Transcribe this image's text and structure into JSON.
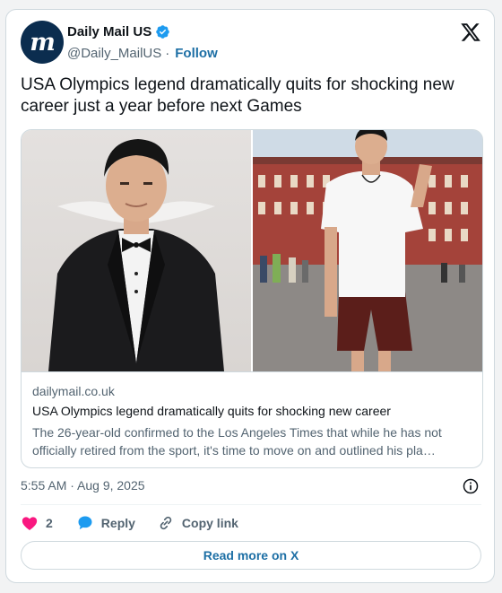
{
  "author": {
    "display_name": "Daily Mail US",
    "handle": "@Daily_MailUS",
    "separator": "·",
    "follow_label": "Follow",
    "avatar_letter": "m"
  },
  "tweet": {
    "text": "USA Olympics legend dramatically quits for shocking new career just a year before next Games"
  },
  "link_card": {
    "domain": "dailymail.co.uk",
    "title": "USA Olympics legend dramatically quits for shocking new career",
    "description": "The 26-year-old confirmed to the Los Angeles Times that while he has not officially retired from the sport, it's time to move on and outlined his pla…"
  },
  "meta": {
    "timestamp": "5:55 AM · Aug 9, 2025"
  },
  "actions": {
    "like_count": "2",
    "reply_label": "Reply",
    "copy_link_label": "Copy link"
  },
  "footer": {
    "read_more_label": "Read more on X"
  },
  "colors": {
    "accent": "#1d6fa5",
    "like": "#f91880",
    "reply": "#1d9bf0",
    "verified": "#1d9bf0",
    "avatar_bg": "#0b2d4f"
  },
  "icons": {
    "verified": "verified-badge-icon",
    "x": "x-logo-icon",
    "info": "info-icon",
    "like": "heart-icon",
    "reply": "speech-bubble-icon",
    "copy": "link-icon"
  }
}
